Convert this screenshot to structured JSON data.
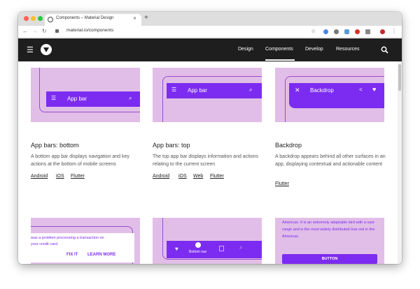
{
  "browser": {
    "tab_title": "Components – Material Design",
    "tab_close": "✕",
    "new_tab": "+",
    "url": "material.io/components",
    "colors": {
      "red": "#ff5f57",
      "yellow": "#febc2e",
      "green": "#28c840"
    }
  },
  "appbar": {
    "menu_icon": "☰",
    "nav": [
      "Design",
      "Components",
      "Develop",
      "Resources"
    ],
    "active_nav": "Components",
    "search_icon": "search-icon"
  },
  "cards": [
    {
      "thumb_title": "App bar",
      "title": "App bars: bottom",
      "description": "A bottom app bar displays navigation and key actions at the bottom of mobile screens",
      "links": [
        "Android",
        "iOS",
        "Flutter"
      ]
    },
    {
      "thumb_title": "App bar",
      "title": "App bars: top",
      "description": "The top app bar displays information and actions relating to the current screen",
      "links": [
        "Android",
        "iOS",
        "Web",
        "Flutter"
      ]
    },
    {
      "thumb_title": "Backdrop",
      "title": "Backdrop",
      "description": "A backdrop appears behind all other surfaces in an app, displaying contextual and actionable content",
      "links": [
        "Flutter"
      ]
    }
  ],
  "row2": {
    "banner_text_line1": "was a problem processing a transaction on",
    "banner_text_line2": "your credit card.",
    "banner_action1": "FIX IT",
    "banner_action2": "LEARN MORE",
    "bottom_nav_label": "Bottom nav",
    "card_text": "The great horned owl is a large owl native to the Americas. It is an extremely adaptable bird with a vast range and is the most widely distributed true owl in the Americas.",
    "card_button": "BUTTON"
  }
}
